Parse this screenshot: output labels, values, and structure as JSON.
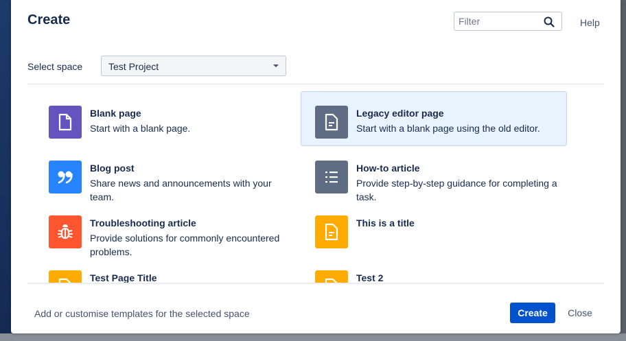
{
  "dialog": {
    "title": "Create",
    "filter_placeholder": "Filter",
    "help_label": "Help"
  },
  "space": {
    "label": "Select space",
    "selected": "Test Project"
  },
  "templates": [
    {
      "title": "Blank page",
      "description": "Start with a blank page.",
      "icon": "page-icon",
      "color": "#6554c0"
    },
    {
      "title": "Legacy editor page",
      "description": "Start with a blank page using the old editor.",
      "icon": "document-icon",
      "color": "#5e6c84",
      "selected": true
    },
    {
      "title": "Blog post",
      "description": "Share news and announcements with your team.",
      "icon": "quote-icon",
      "color": "#2684ff"
    },
    {
      "title": "How-to article",
      "description": "Provide step-by-step guidance for completing a task.",
      "icon": "numbered-list-icon",
      "color": "#5e6c84"
    },
    {
      "title": "Troubleshooting article",
      "description": "Provide solutions for commonly encountered problems.",
      "icon": "bug-icon",
      "color": "#ff5630"
    },
    {
      "title": "This is a title",
      "description": "",
      "icon": "document-icon",
      "color": "#ffab00"
    },
    {
      "title": "Test Page Title",
      "description": "",
      "icon": "document-icon",
      "color": "#ffab00"
    },
    {
      "title": "Test 2",
      "description": "",
      "icon": "document-icon",
      "color": "#ffab00"
    }
  ],
  "footer": {
    "customise_link": "Add or customise templates for the selected space",
    "create_label": "Create",
    "close_label": "Close"
  }
}
